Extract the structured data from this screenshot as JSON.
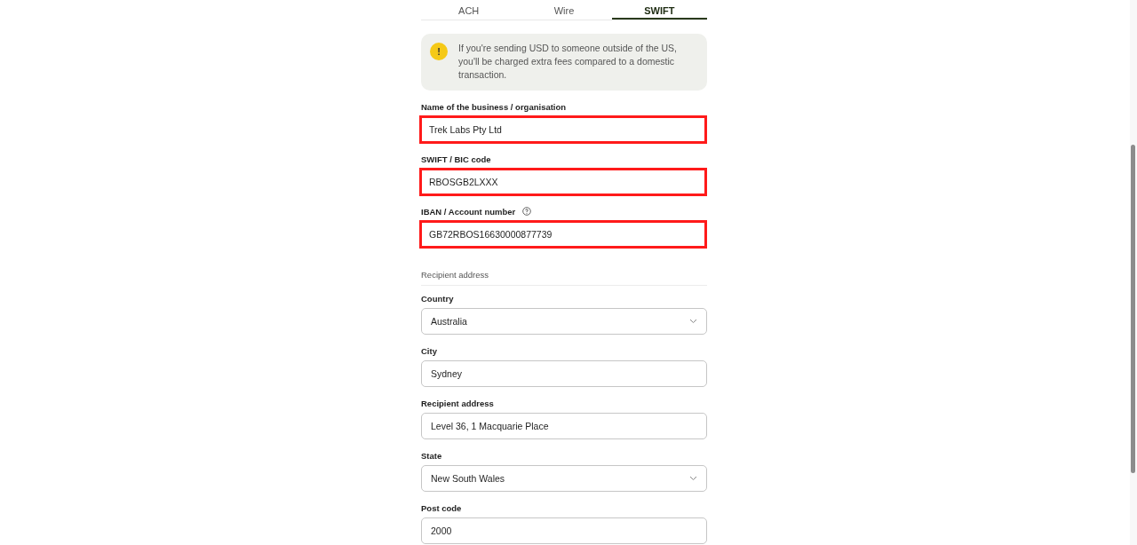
{
  "tabs": [
    {
      "label": "ACH",
      "selected": false
    },
    {
      "label": "Wire",
      "selected": false
    },
    {
      "label": "SWIFT",
      "selected": true
    }
  ],
  "notice": {
    "icon": "!",
    "text": "If you're sending USD to someone outside of the US, you'll be charged extra fees compared to a domestic transaction."
  },
  "fields": [
    {
      "kind": "text",
      "label": "Name of the business / organisation",
      "value": "Trek Labs Pty Ltd",
      "highlighted": true
    },
    {
      "kind": "text",
      "label": "SWIFT / BIC code",
      "value": "RBOSGB2LXXX",
      "highlighted": true
    },
    {
      "kind": "text",
      "label": "IBAN / Account number",
      "value": "GB72RBOS16630000877739",
      "highlighted": true,
      "help": true
    },
    {
      "kind": "heading",
      "label": "Recipient address"
    },
    {
      "kind": "select",
      "label": "Country",
      "value": "Australia",
      "highlighted": false
    },
    {
      "kind": "text",
      "label": "City",
      "value": "Sydney",
      "highlighted": false
    },
    {
      "kind": "text",
      "label": "Recipient address",
      "value": "Level 36, 1 Macquarie Place",
      "highlighted": false
    },
    {
      "kind": "select",
      "label": "State",
      "value": "New South Wales",
      "highlighted": false
    },
    {
      "kind": "text",
      "label": "Post code",
      "value": "2000",
      "highlighted": false
    }
  ]
}
